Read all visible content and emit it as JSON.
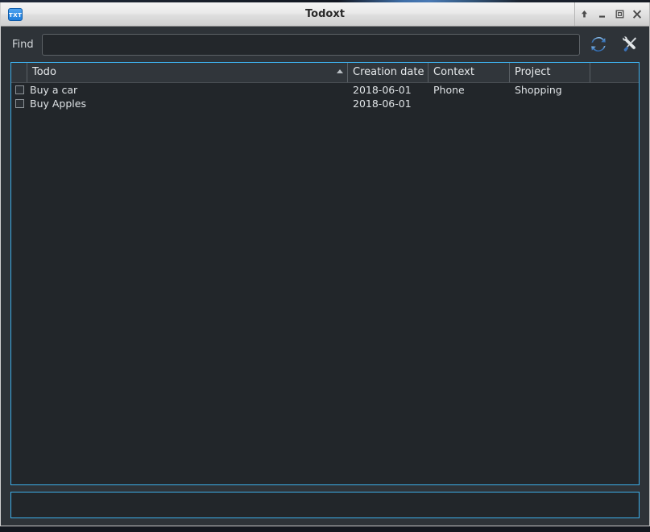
{
  "window": {
    "title": "Todoxt",
    "app_icon_label": "TXT",
    "controls": [
      {
        "name": "shade-button",
        "icon": "up-arrow-icon"
      },
      {
        "name": "minimize-button",
        "icon": "minimize-icon"
      },
      {
        "name": "maximize-button",
        "icon": "maximize-icon"
      },
      {
        "name": "close-button",
        "icon": "close-icon"
      }
    ]
  },
  "toolbar": {
    "find_label": "Find",
    "find_value": "",
    "find_placeholder": "",
    "refresh_icon": "refresh-icon",
    "tools_icon": "tools-icon"
  },
  "table": {
    "columns": [
      {
        "key": "check",
        "label": ""
      },
      {
        "key": "todo",
        "label": "Todo",
        "sorted": "ascending"
      },
      {
        "key": "created",
        "label": "Creation date"
      },
      {
        "key": "context",
        "label": "Context"
      },
      {
        "key": "project",
        "label": "Project"
      },
      {
        "key": "spare",
        "label": ""
      }
    ],
    "rows": [
      {
        "checked": false,
        "todo": "Buy a car",
        "created": "2018-06-01",
        "context": "Phone",
        "project": "Shopping"
      },
      {
        "checked": false,
        "todo": "Buy Apples",
        "created": "2018-06-01",
        "context": "",
        "project": ""
      }
    ]
  },
  "bottom_panel": {
    "text": ""
  },
  "colors": {
    "accent": "#3daee9",
    "window_bg": "#2e3338",
    "list_bg": "#22262a",
    "header_bg": "#31363b",
    "text": "#dfe3e6"
  }
}
